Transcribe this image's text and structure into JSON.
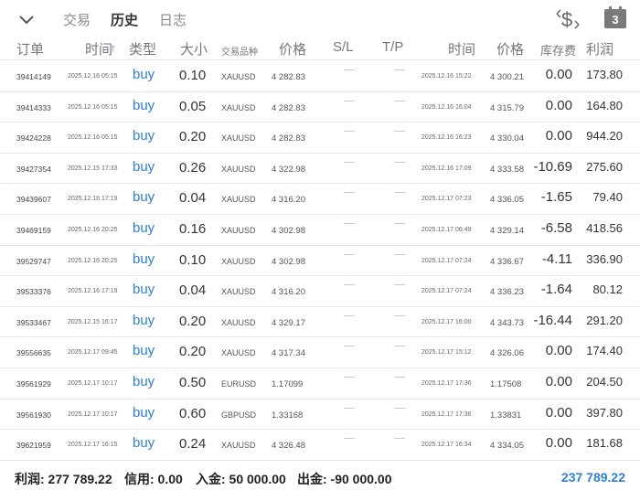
{
  "topbar": {
    "tabs": [
      {
        "label": "交易"
      },
      {
        "label": "历史"
      },
      {
        "label": "日志"
      }
    ],
    "calendar_day": "3",
    "accent_color": "#2b7fd6"
  },
  "columns": {
    "order": "订单",
    "time": "时间",
    "sort_arrow": "↑",
    "type": "类型",
    "size": "大小",
    "symbol": "交易品种",
    "price": "价格",
    "sl": "S/L",
    "tp": "T/P",
    "time_close": "时间",
    "price_close": "价格",
    "swap": "库存费",
    "profit": "利润"
  },
  "rows": [
    {
      "order": "39414149",
      "time": "2025.12.16 05:15",
      "type": "buy",
      "size": "0.10",
      "symbol": "XAUUSD",
      "price": "4 282.83",
      "time_close": "2025.12.16 15:22",
      "price_close": "4 300.21",
      "swap": "0.00",
      "profit": "173.80"
    },
    {
      "order": "39414333",
      "time": "2025.12.16 05:15",
      "type": "buy",
      "size": "0.05",
      "symbol": "XAUUSD",
      "price": "4 282.83",
      "time_close": "2025.12.16 16:04",
      "price_close": "4 315.79",
      "swap": "0.00",
      "profit": "164.80"
    },
    {
      "order": "39424228",
      "time": "2025.12.16 05:15",
      "type": "buy",
      "size": "0.20",
      "symbol": "XAUUSD",
      "price": "4 282.83",
      "time_close": "2025.12.16 16:23",
      "price_close": "4 330.04",
      "swap": "0.00",
      "profit": "944.20"
    },
    {
      "order": "39427354",
      "time": "2025.12.15 17:33",
      "type": "buy",
      "size": "0.26",
      "symbol": "XAUUSD",
      "price": "4 322.98",
      "time_close": "2025.12.16 17:09",
      "price_close": "4 333.58",
      "swap": "-10.69",
      "profit": "275.60"
    },
    {
      "order": "39439607",
      "time": "2025.12.16 17:19",
      "type": "buy",
      "size": "0.04",
      "symbol": "XAUUSD",
      "price": "4 316.20",
      "time_close": "2025.12.17 07:23",
      "price_close": "4 336.05",
      "swap": "-1.65",
      "profit": "79.40"
    },
    {
      "order": "39469159",
      "time": "2025.12.16 20:25",
      "type": "buy",
      "size": "0.16",
      "symbol": "XAUUSD",
      "price": "4 302.98",
      "time_close": "2025.12.17 06:49",
      "price_close": "4 329.14",
      "swap": "-6.58",
      "profit": "418.56"
    },
    {
      "order": "39529747",
      "time": "2025.12.16 20:25",
      "type": "buy",
      "size": "0.10",
      "symbol": "XAUUSD",
      "price": "4 302.98",
      "time_close": "2025.12.17 07:24",
      "price_close": "4 336.67",
      "swap": "-4.11",
      "profit": "336.90"
    },
    {
      "order": "39533376",
      "time": "2025.12.16 17:19",
      "type": "buy",
      "size": "0.04",
      "symbol": "XAUUSD",
      "price": "4 316.20",
      "time_close": "2025.12.17 07:24",
      "price_close": "4 336.23",
      "swap": "-1.64",
      "profit": "80.12"
    },
    {
      "order": "39533467",
      "time": "2025.12.15 16:17",
      "type": "buy",
      "size": "0.20",
      "symbol": "XAUUSD",
      "price": "4 329.17",
      "time_close": "2025.12.17 16:00",
      "price_close": "4 343.73",
      "swap": "-16.44",
      "profit": "291.20"
    },
    {
      "order": "39556635",
      "time": "2025.12.17 09:45",
      "type": "buy",
      "size": "0.20",
      "symbol": "XAUUSD",
      "price": "4 317.34",
      "time_close": "2025.12.17 15:12",
      "price_close": "4 326.06",
      "swap": "0.00",
      "profit": "174.40"
    },
    {
      "order": "39561929",
      "time": "2025.12.17 10:17",
      "type": "buy",
      "size": "0.50",
      "symbol": "EURUSD",
      "price": "1.17099",
      "time_close": "2025.12.17 17:36",
      "price_close": "1.17508",
      "swap": "0.00",
      "profit": "204.50"
    },
    {
      "order": "39561930",
      "time": "2025.12.17 10:17",
      "type": "buy",
      "size": "0.60",
      "symbol": "GBPUSD",
      "price": "1.33168",
      "time_close": "2025.12.17 17:36",
      "price_close": "1.33831",
      "swap": "0.00",
      "profit": "397.80"
    },
    {
      "order": "39621959",
      "time": "2025.12.17 16:15",
      "type": "buy",
      "size": "0.24",
      "symbol": "XAUUSD",
      "price": "4 326.48",
      "time_close": "2025.12.17 16:34",
      "price_close": "4 334.05",
      "swap": "0.00",
      "profit": "181.68"
    }
  ],
  "summary": {
    "profit": "利润: 277 789.22",
    "credit": "信用: 0.00",
    "deposit": "入金: 50 000.00",
    "withdrawal": "出金: -90 000.00",
    "balance": "237 789.22"
  }
}
